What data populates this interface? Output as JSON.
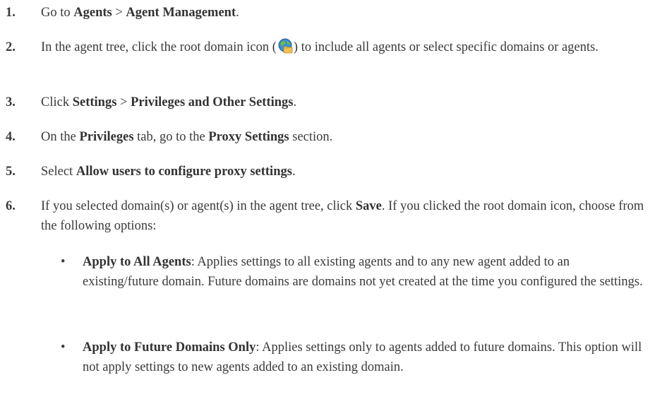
{
  "steps": [
    {
      "num": "1.",
      "t1": "Go to ",
      "b1": "Agents",
      "t2": " > ",
      "b2": "Agent Management",
      "t3": "."
    },
    {
      "num": "2.",
      "t1": "In the agent tree, click the root domain icon (",
      "t2": ") to include all agents or select specific domains or agents."
    },
    {
      "num": "3.",
      "t1": "Click ",
      "b1": "Settings",
      "t2": " > ",
      "b2": "Privileges and Other Settings",
      "t3": "."
    },
    {
      "num": "4.",
      "t1": "On the ",
      "b1": "Privileges",
      "t2": " tab, go to the ",
      "b2": "Proxy Settings",
      "t3": " section."
    },
    {
      "num": "5.",
      "t1": "Select ",
      "b1": "Allow users to configure proxy settings",
      "t2": "."
    },
    {
      "num": "6.",
      "t1": "If you selected domain(s) or agent(s) in the agent tree, click ",
      "b1": "Save",
      "t2": ". If you clicked the root domain icon, choose from the following options:"
    }
  ],
  "options": [
    {
      "bullet": "•",
      "title": "Apply to All Agents",
      "desc": ": Applies settings to all existing agents and to any new agent added to an existing/future domain. Future domains are domains not yet created at the time you configured the settings."
    },
    {
      "bullet": "•",
      "title": "Apply to Future Domains Only",
      "desc": ": Applies settings only to agents added to future domains. This option will not apply settings to new agents added to an existing domain."
    }
  ],
  "icons": {
    "root_domain": "globe-folder-icon"
  }
}
